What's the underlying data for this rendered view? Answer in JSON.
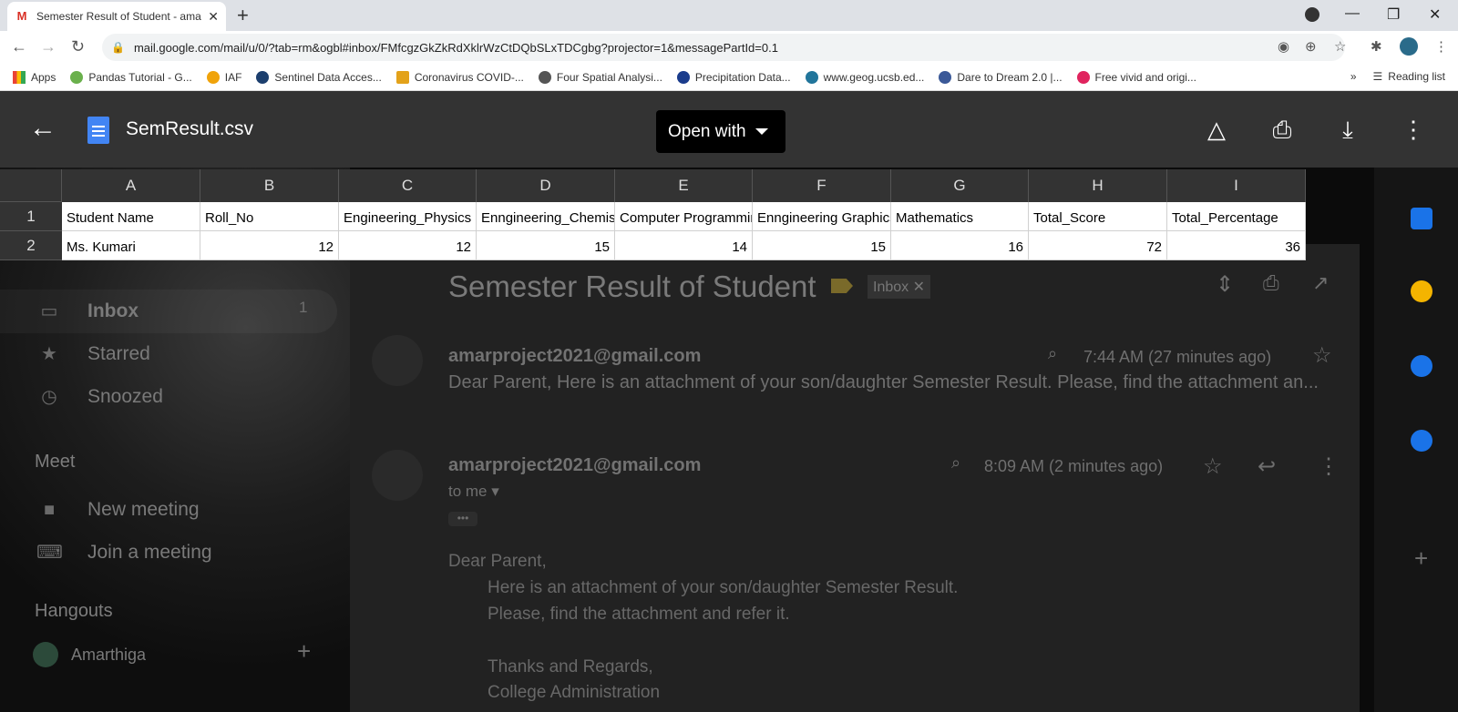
{
  "browser": {
    "tab_title": "Semester Result of Student - ama",
    "tab_favicon": "M",
    "url": "mail.google.com/mail/u/0/?tab=rm&ogbl#inbox/FMfcgzGkZkRdXklrWzCtDQbSLxTDCgbg?projector=1&messagePartId=0.1",
    "bookmarks": [
      "Apps",
      "Pandas Tutorial - G...",
      "IAF",
      "Sentinel Data Acces...",
      "Coronavirus COVID-...",
      "Four Spatial Analysi...",
      "Precipitation Data...",
      "www.geog.ucsb.ed...",
      "Dare to Dream 2.0 |...",
      "Free vivid and origi..."
    ],
    "bookmark_more": "»",
    "reading_list": "Reading list"
  },
  "preview": {
    "file_name": "SemResult.csv",
    "open_with": "Open with"
  },
  "sheet": {
    "columns": [
      "A",
      "B",
      "C",
      "D",
      "E",
      "F",
      "G",
      "H",
      "I"
    ],
    "row_numbers": [
      "1",
      "2"
    ],
    "header_row": [
      "Student Name",
      "Roll_No",
      "Engineering_Physics",
      "Enngineering_Chemistry",
      "Computer Programming",
      "Enngineering Graphics",
      "Mathematics",
      "Total_Score",
      "Total_Percentage"
    ],
    "data_row": [
      "Ms. Kumari",
      "12",
      "12",
      "15",
      "14",
      "15",
      "16",
      "72",
      "36"
    ]
  },
  "gmail": {
    "subject": "Semester Result of Student",
    "label": "Inbox",
    "sidebar": {
      "inbox": "Inbox",
      "inbox_count": "1",
      "starred": "Starred",
      "snoozed": "Snoozed",
      "meet": "Meet",
      "new_meeting": "New meeting",
      "join_meeting": "Join a meeting",
      "hangouts": "Hangouts",
      "user": "Amarthiga"
    },
    "msg1": {
      "sender": "amarproject2021@gmail.com",
      "time": "7:44 AM (27 minutes ago)",
      "snippet": "Dear Parent, Here is an attachment of your son/daughter Semester Result. Please, find the attachment an..."
    },
    "msg2": {
      "sender": "amarproject2021@gmail.com",
      "time": "8:09 AM (2 minutes ago)",
      "to": "to me",
      "body": [
        "Dear Parent,",
        "Here is an attachment of your son/daughter Semester Result.",
        "Please, find the attachment and refer it.",
        "Thanks and Regards,",
        "College Administration"
      ]
    }
  }
}
